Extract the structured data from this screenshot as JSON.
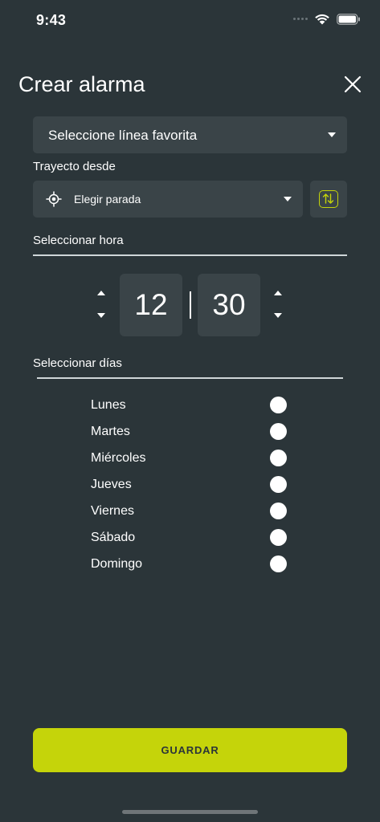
{
  "status_bar": {
    "time": "9:43"
  },
  "header": {
    "title": "Crear alarma"
  },
  "favorite_line": {
    "label": "Seleccione línea favorita"
  },
  "route": {
    "label": "Trayecto desde",
    "stop_label": "Elegir parada"
  },
  "time": {
    "label": "Seleccionar hora",
    "hours": "12",
    "minutes": "30"
  },
  "days": {
    "label": "Seleccionar días",
    "items": [
      "Lunes",
      "Martes",
      "Miércoles",
      "Jueves",
      "Viernes",
      "Sábado",
      "Domingo"
    ]
  },
  "save_label": "GUARDAR",
  "colors": {
    "background": "#2b3539",
    "surface": "#3a4448",
    "accent": "#c5d40a"
  }
}
